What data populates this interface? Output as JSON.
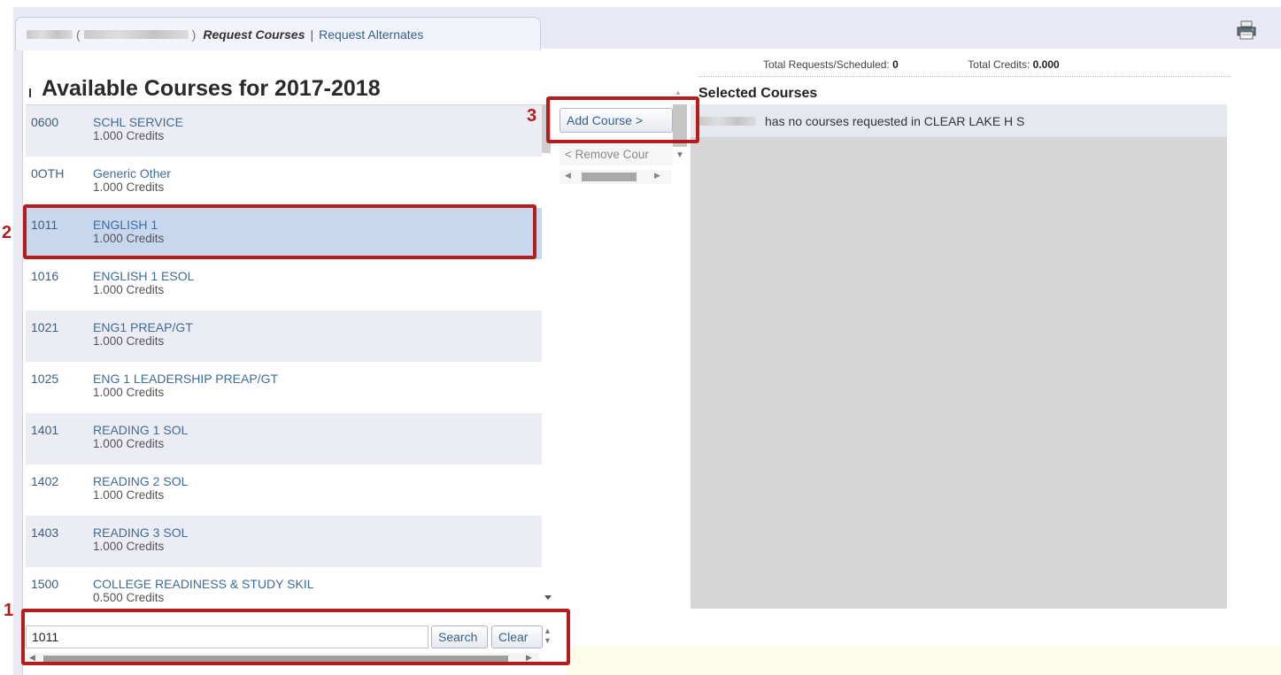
{
  "tabs": {
    "active": "Request Courses",
    "separator": "|",
    "other": "Request Alternates"
  },
  "totals": {
    "requests_label": "Total Requests/Scheduled:",
    "requests_value": "0",
    "credits_label": "Total Credits:",
    "credits_value": "0.000"
  },
  "available": {
    "title": "Available Courses for 2017-2018",
    "courses": [
      {
        "code": "0600",
        "name": "SCHL SERVICE",
        "credits": "1.000 Credits"
      },
      {
        "code": "0OTH",
        "name": "Generic Other",
        "credits": "1.000 Credits"
      },
      {
        "code": "1011",
        "name": "ENGLISH 1",
        "credits": "1.000 Credits"
      },
      {
        "code": "1016",
        "name": "ENGLISH 1 ESOL",
        "credits": "1.000 Credits"
      },
      {
        "code": "1021",
        "name": "ENG1 PREAP/GT",
        "credits": "1.000 Credits"
      },
      {
        "code": "1025",
        "name": "ENG 1 LEADERSHIP PREAP/GT",
        "credits": "1.000 Credits"
      },
      {
        "code": "1401",
        "name": "READING 1 SOL",
        "credits": "1.000 Credits"
      },
      {
        "code": "1402",
        "name": "READING 2 SOL",
        "credits": "1.000 Credits"
      },
      {
        "code": "1403",
        "name": "READING 3 SOL",
        "credits": "1.000 Credits"
      },
      {
        "code": "1500",
        "name": "COLLEGE READINESS & STUDY SKIL",
        "credits": "0.500 Credits"
      }
    ],
    "selected_code": "1011"
  },
  "search": {
    "value": "1011",
    "search_label": "Search",
    "clear_label": "Clear"
  },
  "actions": {
    "add_label": "Add Course >",
    "remove_label": "< Remove Cour"
  },
  "selected": {
    "title": "Selected Courses",
    "empty_message": "has no courses requested in CLEAR LAKE H S"
  },
  "annotations": {
    "n1": "1",
    "n2": "2",
    "n3": "3"
  },
  "colors": {
    "highlight": "#b51c1c",
    "selected_row": "#c7d7ee",
    "link": "#3f6b97"
  },
  "icons": [
    "printer-icon"
  ]
}
